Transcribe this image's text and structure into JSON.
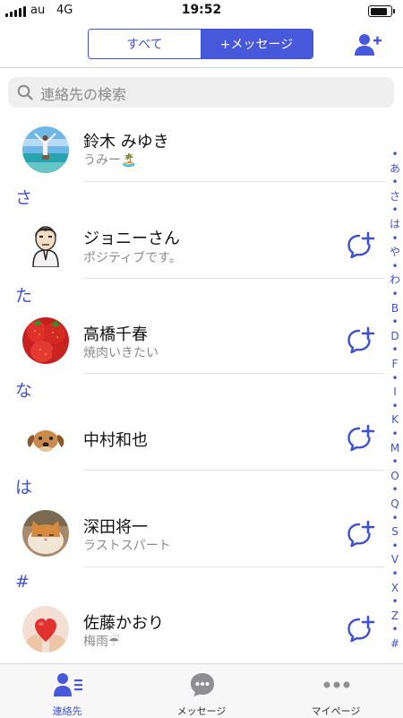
{
  "status_bar": {
    "carrier": "au",
    "network": "4G",
    "time": "19:52",
    "battery_level": 0.9
  },
  "header": {
    "segment_all": "すべて",
    "segment_message": "+メッセージ"
  },
  "search": {
    "placeholder": "連絡先の検索"
  },
  "sections": [
    "さ",
    "た",
    "な",
    "は",
    "#"
  ],
  "contacts": [
    {
      "name": "鈴木 みゆき",
      "status": "うみー🏝️",
      "avatar": "beach-photo",
      "has_message_button": false
    },
    {
      "name": "ジョニーさん",
      "status": "ポジティブです。",
      "avatar": "cartoon-man",
      "has_message_button": true
    },
    {
      "name": "高橋千春",
      "status": "焼肉いきたい",
      "avatar": "strawberries-photo",
      "has_message_button": true
    },
    {
      "name": "中村和也",
      "status": "",
      "avatar": "dog-photo",
      "has_message_button": true
    },
    {
      "name": "深田将一",
      "status": "ラストスパート",
      "avatar": "cat-photo",
      "has_message_button": true
    },
    {
      "name": "佐藤かおり",
      "status": "梅雨☔",
      "avatar": "heart-hands-photo",
      "has_message_button": true
    }
  ],
  "index_letters": [
    "•",
    "あ",
    "•",
    "さ",
    "•",
    "は",
    "•",
    "や",
    "•",
    "わ",
    "•",
    "B",
    "•",
    "D",
    "•",
    "F",
    "•",
    "I",
    "•",
    "K",
    "•",
    "M",
    "•",
    "O",
    "•",
    "Q",
    "•",
    "S",
    "•",
    "V",
    "•",
    "X",
    "•",
    "Z",
    "•",
    "#"
  ],
  "tabs": [
    {
      "label": "連絡先",
      "icon": "contacts-icon",
      "active": true
    },
    {
      "label": "メッセージ",
      "icon": "chat-bubble-icon",
      "active": false
    },
    {
      "label": "マイページ",
      "icon": "more-dots-icon",
      "active": false
    }
  ],
  "colors": {
    "accent": "#3f51d1",
    "accent_fill": "#4858db",
    "secondary_text": "#8a8a8a"
  }
}
